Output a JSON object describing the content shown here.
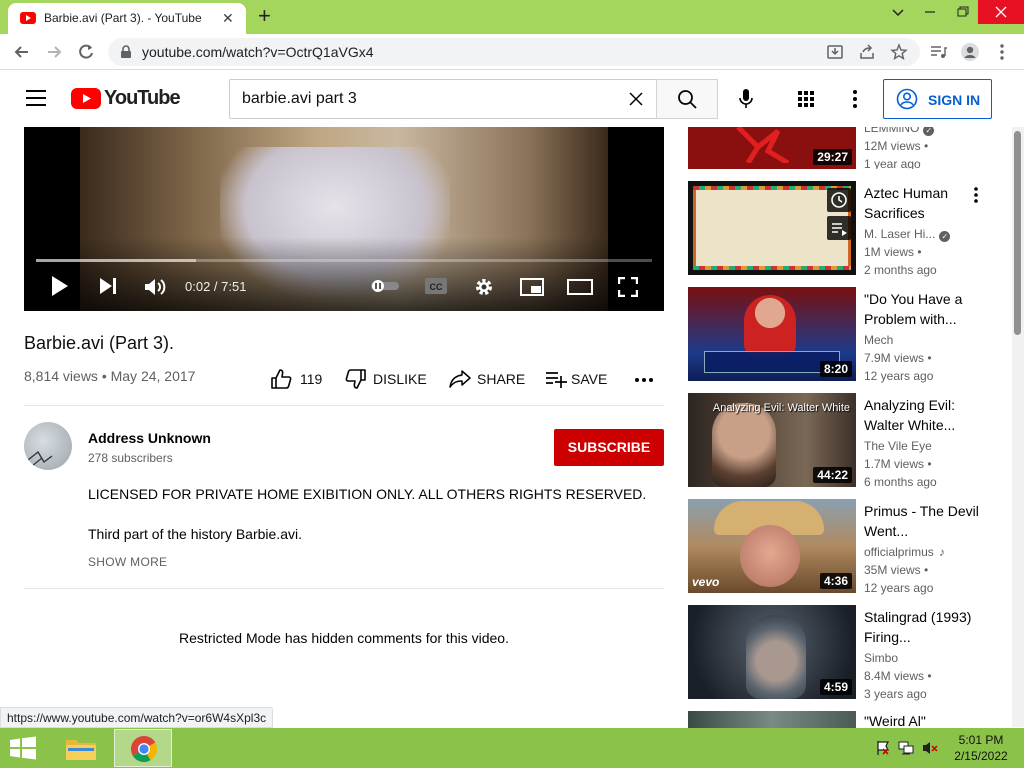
{
  "browser": {
    "tab_title": "Barbie.avi (Part 3). - YouTube",
    "tab_close": "✕",
    "new_tab": "+",
    "url": "youtube.com/watch?v=OctrQ1aVGx4"
  },
  "youtube": {
    "logo_text": "YouTube",
    "search_query": "barbie.avi part 3",
    "sign_in": "SIGN IN"
  },
  "player": {
    "time": "0:02 / 7:51",
    "progress_fraction": 0.005,
    "buffered_fraction": 0.26
  },
  "video": {
    "title": "Barbie.avi (Part 3).",
    "meta": "8,814 views • May 24, 2017",
    "likes": "119",
    "dislike": "DISLIKE",
    "share": "SHARE",
    "save": "SAVE"
  },
  "channel": {
    "name": "Address Unknown",
    "subscribers": "278 subscribers",
    "subscribe": "SUBSCRIBE"
  },
  "description": {
    "line1": "LICENSED FOR PRIVATE HOME EXIBITION ONLY. ALL OTHERS RIGHTS RESERVED.",
    "line2": "Third part of the history Barbie.avi.",
    "show_more": "SHOW MORE"
  },
  "comments": {
    "restricted": "Restricted Mode has hidden comments for this video."
  },
  "recommendations": [
    {
      "title": "",
      "channel": "LEMMiNO",
      "views": "12M views •",
      "age": "1 year ago",
      "duration": "29:27",
      "thumb_color": "#8a1010"
    },
    {
      "title": "Aztec Human Sacrifices",
      "channel": "M. Laser Hi...",
      "views": "1M views •",
      "age": "2 months ago",
      "duration": "",
      "thumb_color": "#ece3c8"
    },
    {
      "title": "\"Do You Have a Problem with...",
      "channel": "Mech",
      "views": "7.9M views •",
      "age": "12 years ago",
      "duration": "8:20",
      "thumb_color": "#1d3a8a"
    },
    {
      "title": "Analyzing Evil: Walter White...",
      "channel": "The Vile Eye",
      "views": "1.7M views •",
      "age": "6 months ago",
      "duration": "44:22",
      "thumb_color": "#4a3a2c",
      "thumb_text": "Analyzing Evil: Walter White"
    },
    {
      "title": "Primus - The Devil Went...",
      "channel": "officialprimus",
      "views": "35M views •",
      "age": "12 years ago",
      "duration": "4:36",
      "thumb_color": "#9c6e40",
      "thumb_text": "vevo"
    },
    {
      "title": "Stalingrad (1993) Firing...",
      "channel": "Simbo",
      "views": "8.4M views •",
      "age": "3 years ago",
      "duration": "4:59",
      "thumb_color": "#2a3340"
    },
    {
      "title": "\"Weird Al\"",
      "channel": "",
      "views": "",
      "age": "",
      "duration": "",
      "thumb_color": "#5a6a66"
    }
  ],
  "status_link": "https://www.youtube.com/watch?v=or6W4sXpl3c",
  "taskbar": {
    "time": "5:01 PM",
    "date": "2/15/2022"
  },
  "colors": {
    "chrome_frame": "#a4d65e",
    "taskbar": "#8bc34a",
    "yt_red": "#ff0000",
    "subscribe_red": "#cc0000",
    "link_blue": "#065fd4"
  }
}
